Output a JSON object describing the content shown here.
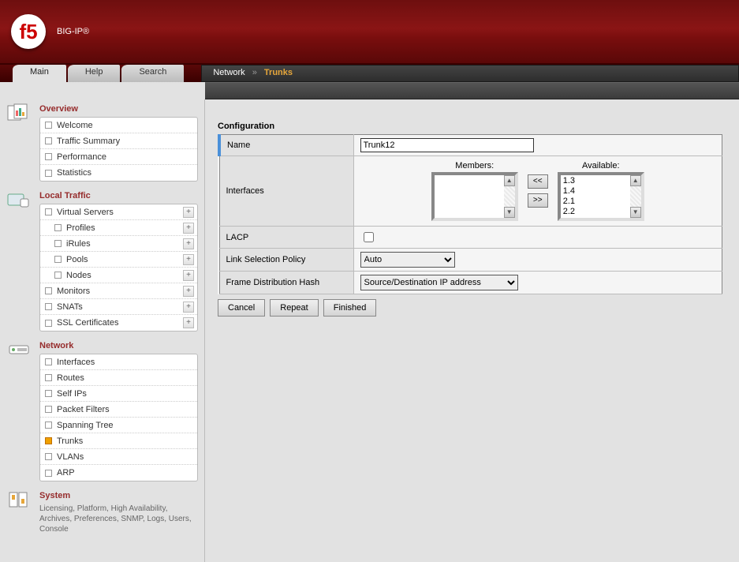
{
  "header": {
    "product": "BIG-IP®"
  },
  "tabs": {
    "main": "Main",
    "help": "Help",
    "search": "Search"
  },
  "breadcrumb": {
    "section": "Network",
    "current": "Trunks"
  },
  "sidebar": {
    "overview": {
      "title": "Overview",
      "items": [
        "Welcome",
        "Traffic Summary",
        "Performance",
        "Statistics"
      ]
    },
    "local_traffic": {
      "title": "Local Traffic",
      "items": [
        {
          "label": "Virtual Servers",
          "expand": true
        },
        {
          "label": "Profiles",
          "indent": true,
          "expand": true
        },
        {
          "label": "iRules",
          "indent": true,
          "expand": true
        },
        {
          "label": "Pools",
          "indent": true,
          "expand": true
        },
        {
          "label": "Nodes",
          "indent": true,
          "expand": true
        },
        {
          "label": "Monitors",
          "expand": true
        },
        {
          "label": "SNATs",
          "expand": true
        },
        {
          "label": "SSL Certificates",
          "expand": true
        }
      ]
    },
    "network": {
      "title": "Network",
      "items": [
        {
          "label": "Interfaces"
        },
        {
          "label": "Routes"
        },
        {
          "label": "Self IPs"
        },
        {
          "label": "Packet Filters"
        },
        {
          "label": "Spanning Tree"
        },
        {
          "label": "Trunks",
          "active": true
        },
        {
          "label": "VLANs"
        },
        {
          "label": "ARP"
        }
      ]
    },
    "system": {
      "title": "System",
      "desc": "Licensing, Platform, High Availability, Archives, Preferences, SNMP, Logs, Users, Console"
    }
  },
  "form": {
    "title": "Configuration",
    "labels": {
      "name": "Name",
      "interfaces": "Interfaces",
      "lacp": "LACP",
      "link_selection": "Link Selection Policy",
      "frame_dist": "Frame Distribution Hash"
    },
    "name_value": "Trunk12",
    "interfaces_headers": {
      "members": "Members:",
      "available": "Available:"
    },
    "shuttle": {
      "left": "<<",
      "right": ">>"
    },
    "available_items": [
      "1.3",
      "1.4",
      "2.1",
      "2.2"
    ],
    "link_selection_value": "Auto",
    "frame_dist_value": "Source/Destination IP address",
    "buttons": {
      "cancel": "Cancel",
      "repeat": "Repeat",
      "finished": "Finished"
    }
  }
}
